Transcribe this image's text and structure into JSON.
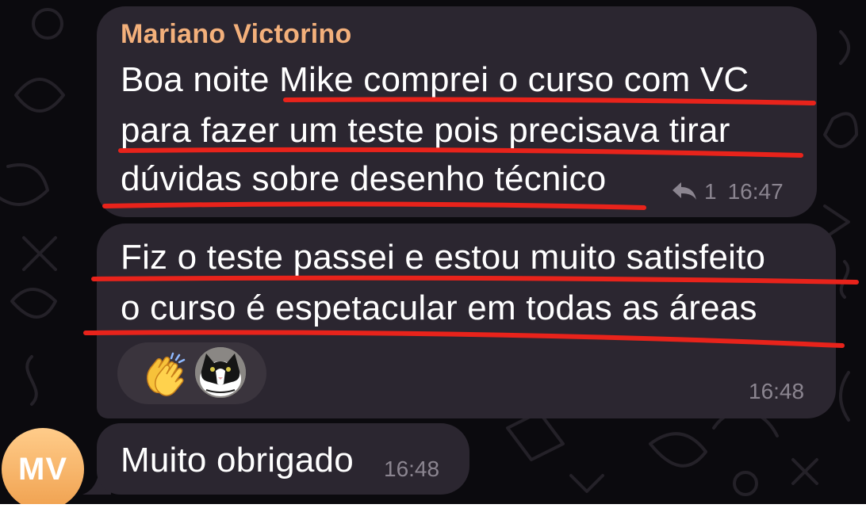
{
  "messages": [
    {
      "sender": "Mariano Victorino",
      "lines": [
        "Boa noite Mike comprei o curso com VC",
        "para fazer um teste pois precisava tirar",
        "dúvidas sobre desenho técnico"
      ],
      "reply_count": "1",
      "time": "16:47"
    },
    {
      "lines": [
        "Fiz o teste passei e estou muito satisfeito",
        "o curso é espetacular em todas as áreas"
      ],
      "reactions": [
        "clapping-hands-emoji",
        "cat-avatar"
      ],
      "time": "16:48"
    },
    {
      "lines": [
        "Muito obrigado"
      ],
      "time": "16:48"
    }
  ],
  "avatar": {
    "initials": "MV"
  },
  "colors": {
    "bubble": "#2b2630",
    "sender_name": "#f3b07b",
    "timestamp": "#8b8590",
    "annotation_red": "#e8231b",
    "avatar_gradient_top": "#ffcc8a",
    "avatar_gradient_bottom": "#f0a14f"
  },
  "icons": [
    "reply-arrow-icon",
    "clapping-hands-emoji",
    "cat-avatar"
  ]
}
